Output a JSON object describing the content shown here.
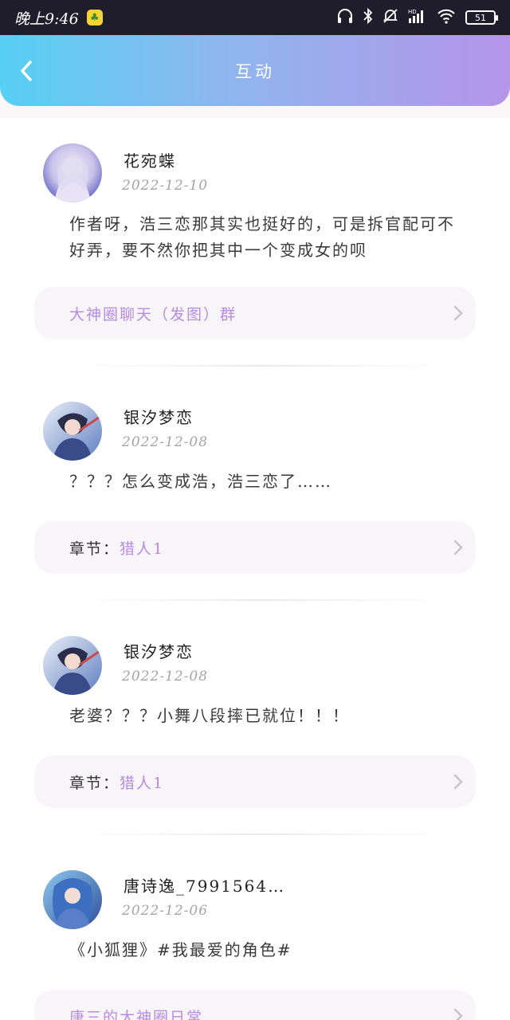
{
  "status_bar": {
    "time": "晚上9:46",
    "battery": "51"
  },
  "header": {
    "title": "互动"
  },
  "posts": [
    {
      "username": "花宛蝶",
      "date": "2022-12-10",
      "comment": "作者呀，浩三恋那其实也挺好的，可是拆官配可不好弄，要不然你把其中一个变成女的呗",
      "link_prefix": "",
      "link_text": "大神圈聊天（发图）群"
    },
    {
      "username": "银汐梦恋",
      "date": "2022-12-08",
      "comment": "？？？怎么变成浩，浩三恋了……",
      "link_prefix": "章节：",
      "link_text": "猎人1"
    },
    {
      "username": "银汐梦恋",
      "date": "2022-12-08",
      "comment": "老婆？？？小舞八段摔已就位！！！",
      "link_prefix": "章节：",
      "link_text": "猎人1"
    },
    {
      "username": "唐诗逸_7991564…",
      "date": "2022-12-06",
      "comment": "《小狐狸》#我最爱的角色#",
      "link_prefix": "",
      "link_text": "唐三的大神圈日常"
    }
  ],
  "colors": {
    "header_gradient_start": "#56d0f2",
    "header_gradient_end": "#b595e8",
    "link_color": "#b58ce0",
    "date_color": "#a8a3a6"
  }
}
